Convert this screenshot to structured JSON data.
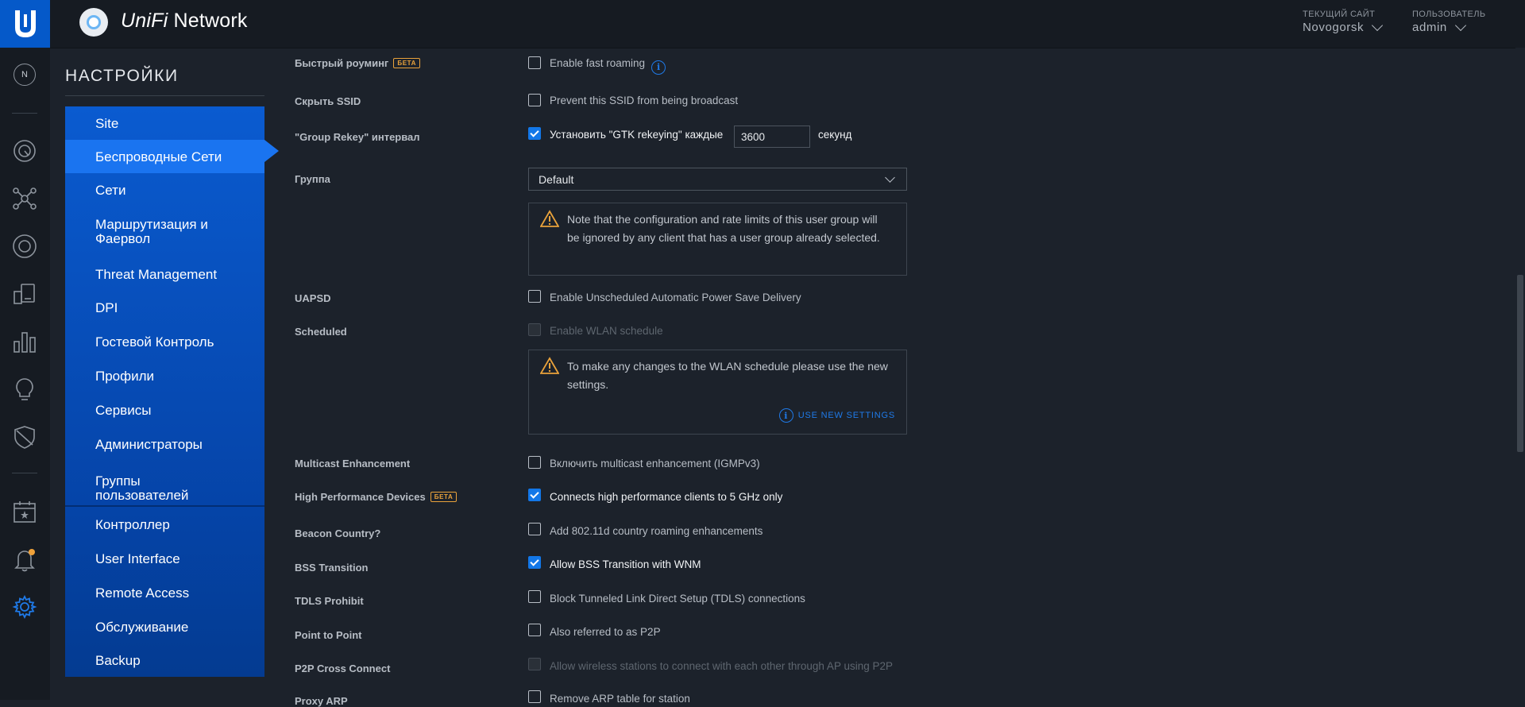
{
  "header": {
    "app_name_prefix": "UniFi",
    "app_name_suffix": "Network",
    "site_caption": "ТЕКУЩИЙ САЙТ",
    "site_value": "Novogorsk",
    "user_caption": "ПОЛЬЗОВАТЕЛЬ",
    "user_value": "admin"
  },
  "rail": {
    "site_badge": "N",
    "icons": [
      "dashboard-icon",
      "topology-icon",
      "devices-icon",
      "clients-icon",
      "statistics-icon",
      "insights-icon",
      "threat-shield-icon",
      "events-calendar-icon",
      "alerts-bell-icon",
      "settings-gear-icon"
    ],
    "alert_color": "#f0a23a",
    "active_color": "#1f7ae8"
  },
  "settings_nav": {
    "title": "НАСТРОЙКИ",
    "items": [
      {
        "label": "Site"
      },
      {
        "label": "Беспроводные Сети"
      },
      {
        "label": "Сети"
      },
      {
        "label": "Маршрутизация и Фаервол"
      },
      {
        "label": "Threat Management"
      },
      {
        "label": "DPI"
      },
      {
        "label": "Гостевой Контроль"
      },
      {
        "label": "Профили"
      },
      {
        "label": "Сервисы"
      },
      {
        "label": "Администраторы"
      },
      {
        "label": "Группы пользователей"
      },
      {
        "label": "Контроллер"
      },
      {
        "label": "User Interface"
      },
      {
        "label": "Remote Access"
      },
      {
        "label": "Обслуживание"
      },
      {
        "label": "Backup"
      }
    ],
    "active_index": 1
  },
  "form": {
    "beta_label": "БЕТА",
    "fast_roaming": {
      "label": "Быстрый роуминг",
      "checkbox": "Enable fast roaming",
      "checked": false
    },
    "hide_ssid": {
      "label": "Скрыть SSID",
      "checkbox": "Prevent this SSID from being broadcast",
      "checked": false
    },
    "group_rekey": {
      "label": "\"Group Rekey\" интервал",
      "checkbox": "Установить \"GTK rekeying\" каждые",
      "value": "3600",
      "unit": "секунд",
      "checked": true
    },
    "group": {
      "label": "Группа",
      "selected": "Default"
    },
    "group_warning": "Note that the configuration and rate limits of this user group will be ignored by any client that has a user group already selected.",
    "uapsd": {
      "label": "UAPSD",
      "checkbox": "Enable Unscheduled Automatic Power Save Delivery",
      "checked": false
    },
    "scheduled": {
      "label": "Scheduled",
      "checkbox": "Enable WLAN schedule",
      "checked": false,
      "disabled": true
    },
    "schedule_warning": "To make any changes to the WLAN schedule please use the new settings.",
    "use_new_settings": "USE NEW SETTINGS",
    "multicast": {
      "label": "Multicast Enhancement",
      "checkbox": "Включить multicast enhancement (IGMPv3)",
      "checked": false
    },
    "high_perf": {
      "label": "High Performance Devices",
      "checkbox": "Connects high performance clients to 5 GHz only",
      "checked": true
    },
    "beacon": {
      "label": "Beacon Country?",
      "checkbox": "Add 802.11d country roaming enhancements",
      "checked": false
    },
    "bss": {
      "label": "BSS Transition",
      "checkbox": "Allow BSS Transition with WNM",
      "checked": true
    },
    "tdls": {
      "label": "TDLS Prohibit",
      "checkbox": "Block Tunneled Link Direct Setup (TDLS) connections",
      "checked": false
    },
    "p2p": {
      "label": "Point to Point",
      "checkbox": "Also referred to as P2P",
      "checked": false
    },
    "p2p_cross": {
      "label": "P2P Cross Connect",
      "checkbox": "Allow wireless stations to connect with each other through AP using P2P",
      "checked": false,
      "disabled": true
    },
    "proxy_arp": {
      "label": "Proxy ARP",
      "checkbox": "Remove ARP table for station",
      "checked": false
    }
  }
}
